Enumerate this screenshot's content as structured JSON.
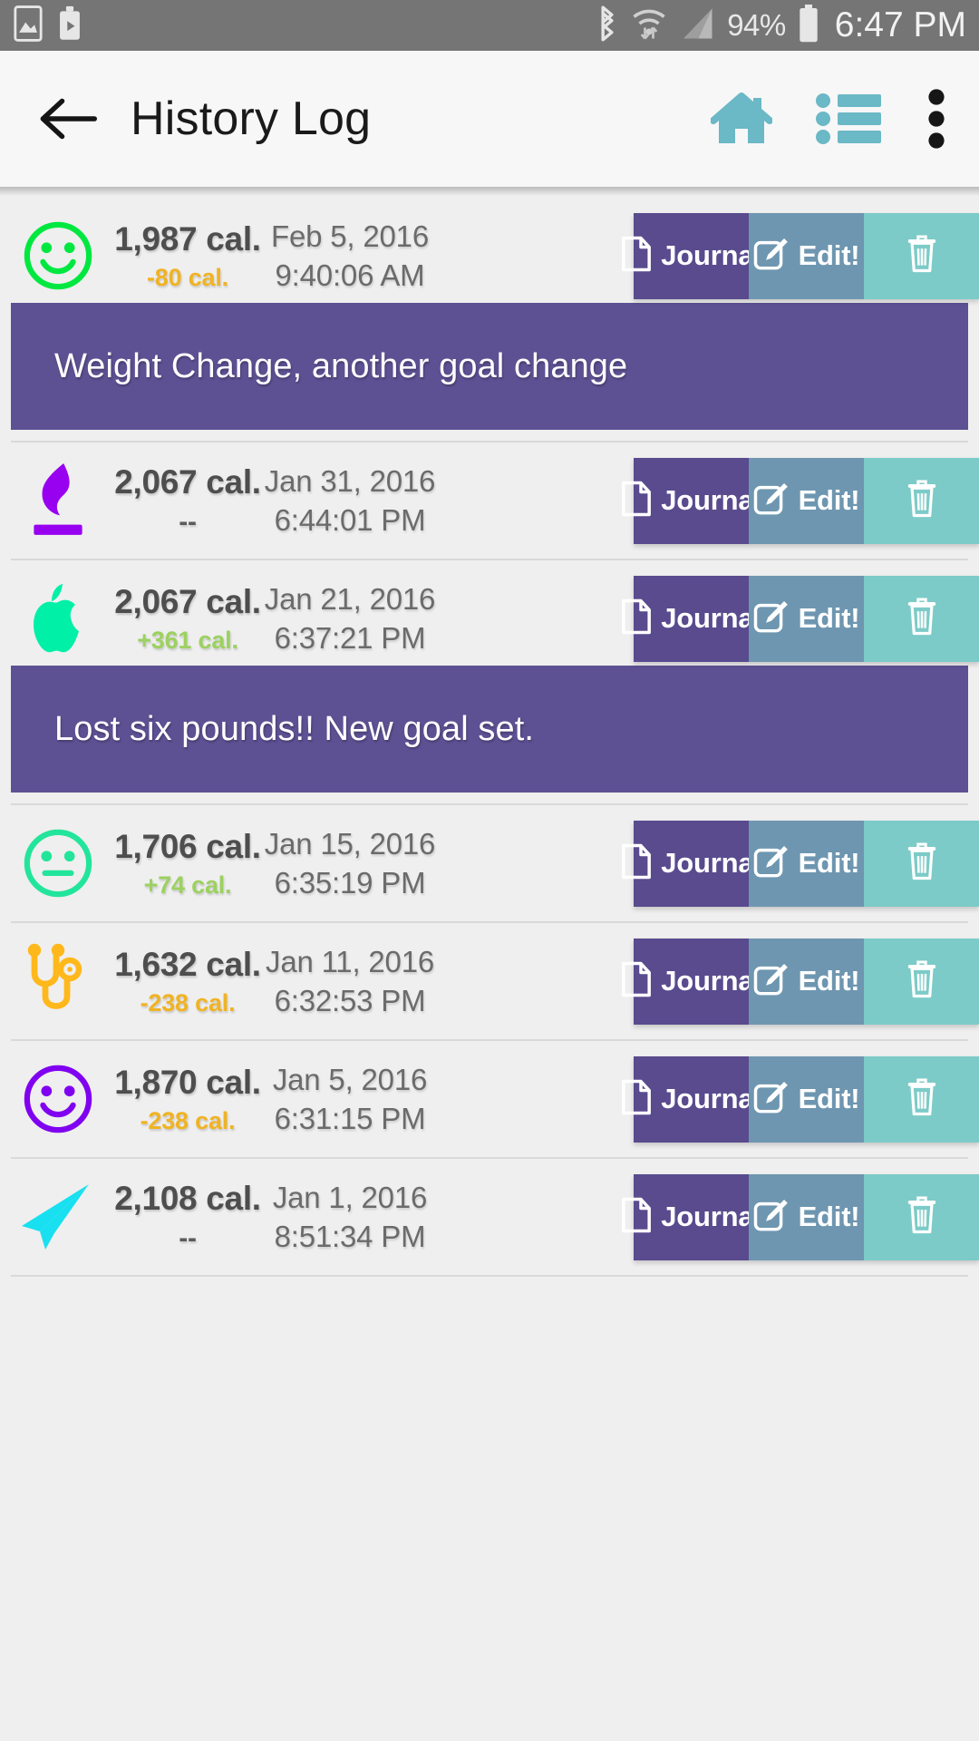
{
  "status_bar": {
    "icons": [
      "screenshot-icon",
      "cast-icon",
      "bluetooth-icon",
      "wifi-icon",
      "cellular-signal-icon",
      "battery-icon"
    ],
    "battery_percent": "94%",
    "time": "6:47 PM",
    "background_color": "#757575"
  },
  "toolbar": {
    "back_label": "back-arrow",
    "title": "History Log",
    "actions": [
      {
        "name": "home-icon",
        "label": "Home"
      },
      {
        "name": "list-icon",
        "label": "List"
      },
      {
        "name": "overflow-menu-icon",
        "label": "More options"
      }
    ],
    "accent_color": "#6BB8C6",
    "background_color": "#F7F7F7"
  },
  "buttons": {
    "journal_label": "Journal",
    "edit_label": "Edit!",
    "delete_label": "",
    "journal_color": "#594B8E",
    "edit_color": "#6E96B0",
    "delete_color": "#7CCBC8"
  },
  "colors": {
    "calorie_negative": "#F0B323",
    "calorie_positive": "#9CD160",
    "note_background": "#5D5193",
    "page_background": "#EFEFEF"
  },
  "entries": [
    {
      "icon": "smiley-face-icon",
      "icon_color": "#00E840",
      "calories": "1,987 cal.",
      "delta": "-80 cal.",
      "delta_sign": "neg",
      "date": "Feb 5, 2016",
      "time": "9:40:06 AM",
      "note": "Weight Change, another goal change"
    },
    {
      "icon": "flame-icon",
      "icon_color": "#9800F0",
      "calories": "2,067 cal.",
      "delta": "--",
      "delta_sign": "none",
      "date": "Jan 31, 2016",
      "time": "6:44:01 PM",
      "note": ""
    },
    {
      "icon": "apple-icon",
      "icon_color": "#00F0A8",
      "calories": "2,067 cal.",
      "delta": "+361 cal.",
      "delta_sign": "pos",
      "date": "Jan 21, 2016",
      "time": "6:37:21 PM",
      "note": "Lost six pounds!!  New goal set."
    },
    {
      "icon": "neutral-face-icon",
      "icon_color": "#22E59B",
      "calories": "1,706 cal.",
      "delta": "+74 cal.",
      "delta_sign": "pos",
      "date": "Jan 15, 2016",
      "time": "6:35:19 PM",
      "note": ""
    },
    {
      "icon": "stethoscope-icon",
      "icon_color": "#FFB81C",
      "calories": "1,632 cal.",
      "delta": "-238 cal.",
      "delta_sign": "neg",
      "date": "Jan 11, 2016",
      "time": "6:32:53 PM",
      "note": ""
    },
    {
      "icon": "smiley-face-icon",
      "icon_color": "#8000F0",
      "calories": "1,870 cal.",
      "delta": "-238 cal.",
      "delta_sign": "neg",
      "date": "Jan 5, 2016",
      "time": "6:31:15 PM",
      "note": ""
    },
    {
      "icon": "paper-plane-icon",
      "icon_color": "#18E0F0",
      "calories": "2,108 cal.",
      "delta": "--",
      "delta_sign": "none",
      "date": "Jan 1, 2016",
      "time": "8:51:34 PM",
      "note": ""
    }
  ]
}
